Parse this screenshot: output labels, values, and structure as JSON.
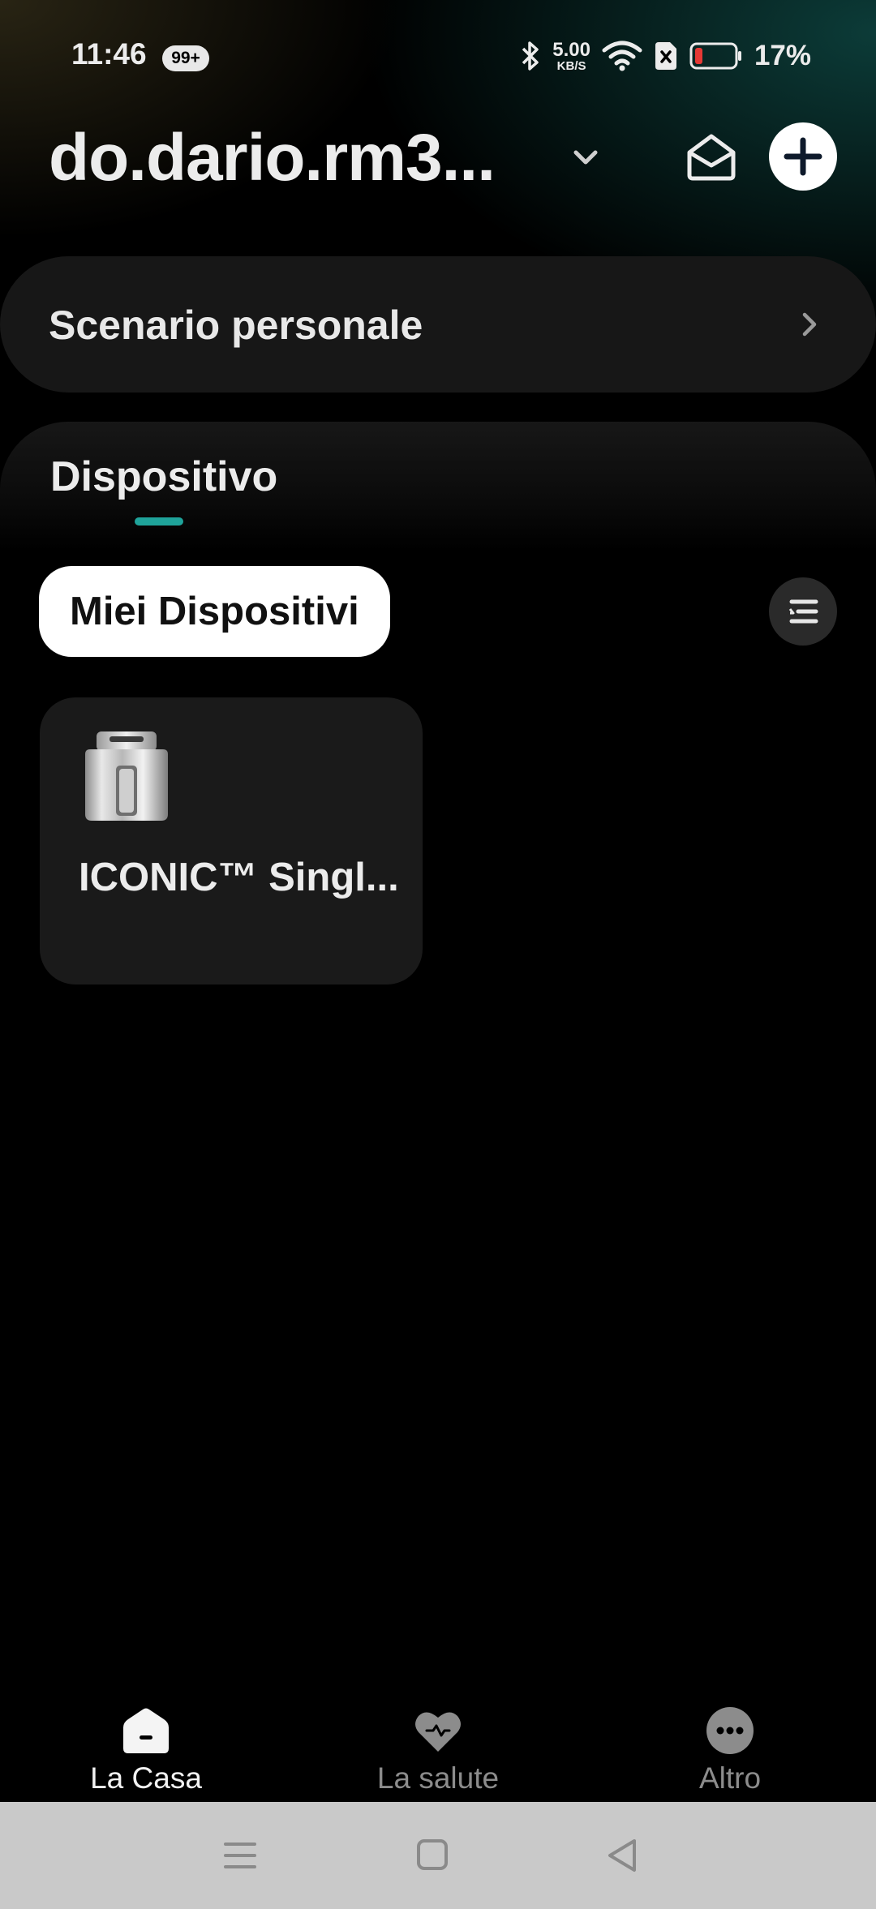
{
  "status_bar": {
    "time": "11:46",
    "notification_badge": "99+",
    "net_speed_value": "5.00",
    "net_speed_unit": "KB/S",
    "battery_percent": "17%",
    "icons": [
      "bluetooth-icon",
      "wifi-icon",
      "sim-disabled-icon",
      "battery-low-icon"
    ]
  },
  "header": {
    "account_title": "do.dario.rm3...",
    "icons": [
      "chevron-down-icon",
      "mail-open-icon",
      "plus-icon"
    ]
  },
  "scenario": {
    "label": "Scenario personale"
  },
  "devices": {
    "tab_label": "Dispositivo",
    "filter_chip": "Miei Dispositivi",
    "items": [
      {
        "name": "ICONIC™ Singl...",
        "image": "air-fryer-image"
      }
    ]
  },
  "bottom_nav": {
    "items": [
      {
        "label": "La Casa",
        "icon": "home-icon",
        "active": true
      },
      {
        "label": "La salute",
        "icon": "heart-icon",
        "active": false
      },
      {
        "label": "Altro",
        "icon": "more-dots-icon",
        "active": false
      }
    ]
  },
  "colors": {
    "accent": "#1fa39a",
    "background": "#000000",
    "card": "#1a1a1a",
    "system_bar": "#c9c9c9"
  }
}
